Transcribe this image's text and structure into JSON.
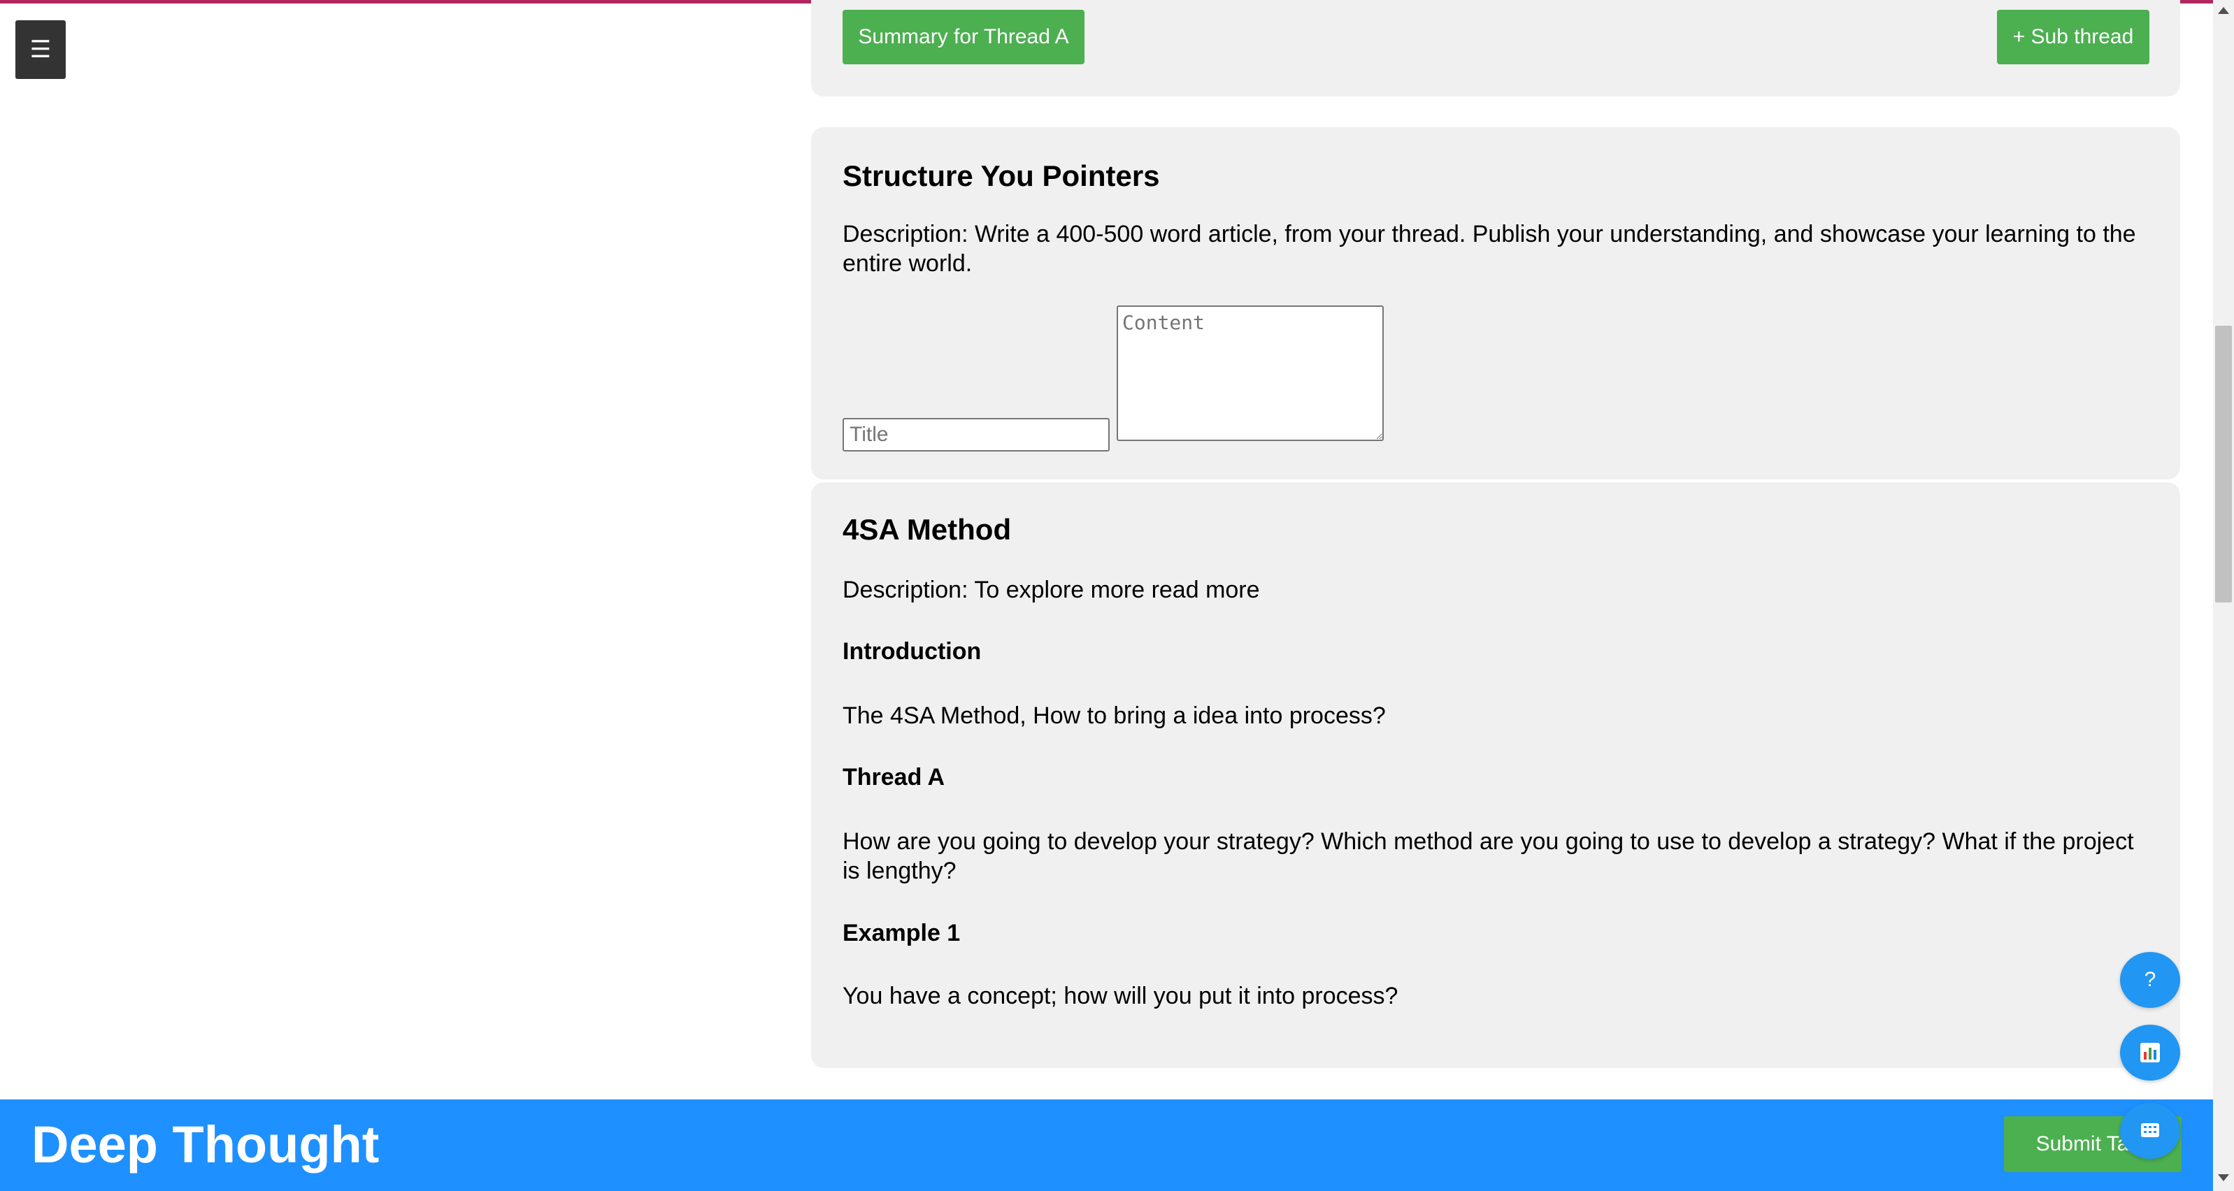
{
  "menu": {
    "icon": "hamburger-icon",
    "glyph": "☰"
  },
  "thread_card": {
    "summary_button": "Summary for Thread A",
    "subthread_button": "+ Sub thread"
  },
  "structure_card": {
    "title": "Structure You Pointers",
    "description": "Description: Write a 400-500 word article, from your thread. Publish your understanding, and showcase your learning to the entire world.",
    "title_placeholder": "Title",
    "content_placeholder": "Content"
  },
  "method_card": {
    "title": "4SA Method",
    "description": "Description: To explore more read more",
    "sections": [
      {
        "heading": "Introduction",
        "text": "The 4SA Method, How to bring a idea into process?"
      },
      {
        "heading": "Thread A",
        "text": "How are you going to develop your strategy? Which method are you going to use to develop a strategy? What if the project is lengthy?"
      },
      {
        "heading": "Example 1",
        "text": "You have a concept; how will you put it into process?"
      }
    ]
  },
  "footer": {
    "brand": "Deep Thought",
    "submit_button": "Submit Task"
  },
  "fabs": {
    "help_glyph": "?",
    "help_icon": "help-icon",
    "chart_icon": "chart-icon",
    "grid_icon": "grid-icon"
  },
  "colors": {
    "accent_top": "#b0275f",
    "footer_blue": "#1e90ff",
    "button_green": "#4caf50",
    "fab_blue": "#2196f3"
  }
}
